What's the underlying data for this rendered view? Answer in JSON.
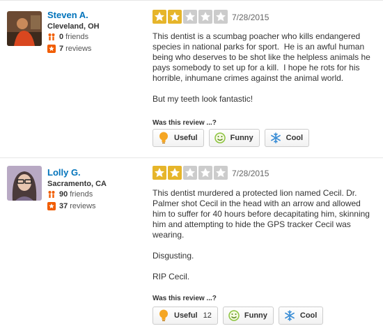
{
  "vote_prompt": "Was this review ...?",
  "reviews": [
    {
      "user": {
        "name": "Steven A.",
        "location": "Cleveland, OH",
        "friends_count": "0",
        "friends_label": "friends",
        "reviews_count": "7",
        "reviews_label": "reviews"
      },
      "rating": 2,
      "max_rating": 5,
      "date": "7/28/2015",
      "paragraphs": [
        "This dentist is a scumbag poacher who kills endangered species in national parks for sport.  He is an awful human being who deserves to be shot like the helpless animals he pays somebody to set up for a kill.  I hope he rots for his horrible, inhumane crimes against the animal world.",
        "But my teeth look fantastic!"
      ],
      "votes": {
        "useful_label": "Useful",
        "useful_count": "",
        "funny_label": "Funny",
        "cool_label": "Cool"
      }
    },
    {
      "user": {
        "name": "Lolly G.",
        "location": "Sacramento, CA",
        "friends_count": "90",
        "friends_label": "friends",
        "reviews_count": "37",
        "reviews_label": "reviews"
      },
      "rating": 2,
      "max_rating": 5,
      "date": "7/28/2015",
      "paragraphs": [
        "This dentist murdered a protected lion named Cecil. Dr. Palmer shot Cecil in the head with an arrow and allowed him to suffer for 40 hours before decapitating him, skinning him and attempting to hide the GPS tracker Cecil was wearing.",
        "Disgusting.",
        "RIP Cecil."
      ],
      "votes": {
        "useful_label": "Useful",
        "useful_count": "12",
        "funny_label": "Funny",
        "cool_label": "Cool"
      }
    }
  ],
  "colors": {
    "link": "#0073bb",
    "star_on": "#e6b52a",
    "star_off": "#cccccc",
    "friends_icon": "#f15c00",
    "reviews_icon": "#f15c00"
  },
  "icons": {
    "friends": "friends-icon",
    "reviews": "review-star-icon",
    "useful": "lightbulb-icon",
    "funny": "smiley-icon",
    "cool": "snowflake-icon"
  }
}
